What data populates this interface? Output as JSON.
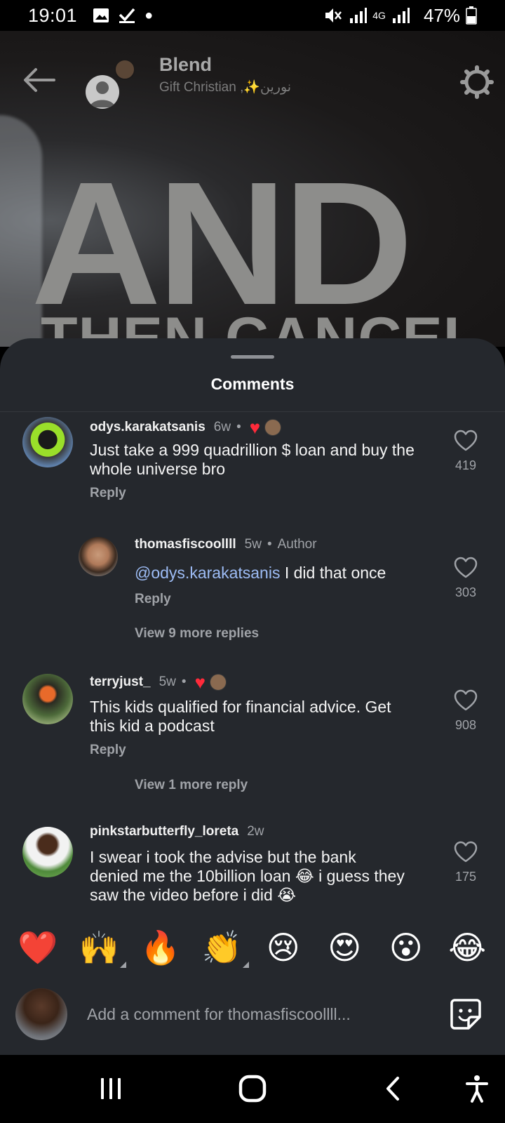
{
  "status_bar": {
    "time": "19:01",
    "network": "4G",
    "battery": "47%"
  },
  "header": {
    "title": "Blend",
    "subtitle": "Gift Christian ,✨نورين"
  },
  "video_text": {
    "line1": "AND",
    "line2": "THEN CANCEL THE"
  },
  "comments_sheet": {
    "title": "Comments",
    "comments": [
      {
        "user": "odys.karakatsanis",
        "time": "6w",
        "text": "Just take a 999 quadrillion $ loan and buy the whole universe bro",
        "reply_label": "Reply",
        "likes": "419"
      },
      {
        "user": "thomasfiscoollll",
        "time": "5w",
        "badge": "Author",
        "mention": "@odys.karakatsanis",
        "text": " I did that once",
        "reply_label": "Reply",
        "likes": "303",
        "view_more": "View 9 more replies"
      },
      {
        "user": "terryjust_",
        "time": "5w",
        "text": "This kids qualified for financial advice. Get this kid a podcast",
        "reply_label": "Reply",
        "likes": "908",
        "view_more": "View 1 more reply"
      },
      {
        "user": "pinkstarbutterfly_loreta",
        "time": "2w",
        "text": "I swear i took the advise but the bank denied me the 10billion loan 😂 i guess they saw the video before i did 😭",
        "likes": "175"
      }
    ]
  },
  "emoji_bar": [
    "❤️",
    "🙌",
    "🔥",
    "👏",
    "😢",
    "😍",
    "😮",
    "😂"
  ],
  "composer": {
    "placeholder": "Add a comment for thomasfiscoollll..."
  },
  "colors": {
    "sheet_bg": "#25282d",
    "mention": "#9dbcf5",
    "heart": "#ff2a3a",
    "secondary_text": "#a0a3a8"
  }
}
